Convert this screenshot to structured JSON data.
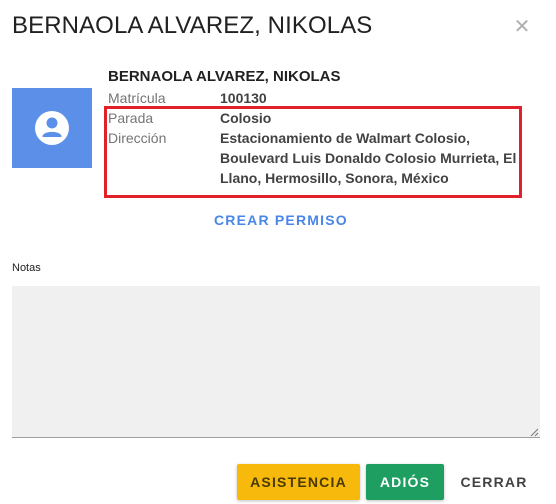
{
  "dialog": {
    "title": "BERNAOLA ALVAREZ, NIKOLAS",
    "close_icon": "close-icon"
  },
  "student": {
    "avatar_icon": "user-avatar-icon",
    "avatar_color": "#5c8fe8",
    "name": "BERNAOLA ALVAREZ, NIKOLAS",
    "fields": {
      "matricula_label": "Matrícula",
      "matricula_value": "100130",
      "parada_label": "Parada",
      "parada_value": "Colosio",
      "direccion_label": "Dirección",
      "direccion_value": "Estacionamiento de Walmart Colosio, Boulevard Luis Donaldo Colosio Murrieta, El Llano, Hermosillo, Sonora, México"
    }
  },
  "crear_permiso_label": "CREAR PERMISO",
  "notas": {
    "label": "Notas",
    "value": ""
  },
  "actions": {
    "asistencia_label": "ASISTENCIA",
    "adios_label": "ADIÓS",
    "cerrar_label": "CERRAR"
  },
  "colors": {
    "highlight": "#e0202a",
    "asistencia": "#f7b90b",
    "adios": "#1f9e62",
    "link": "#4a86e8"
  }
}
